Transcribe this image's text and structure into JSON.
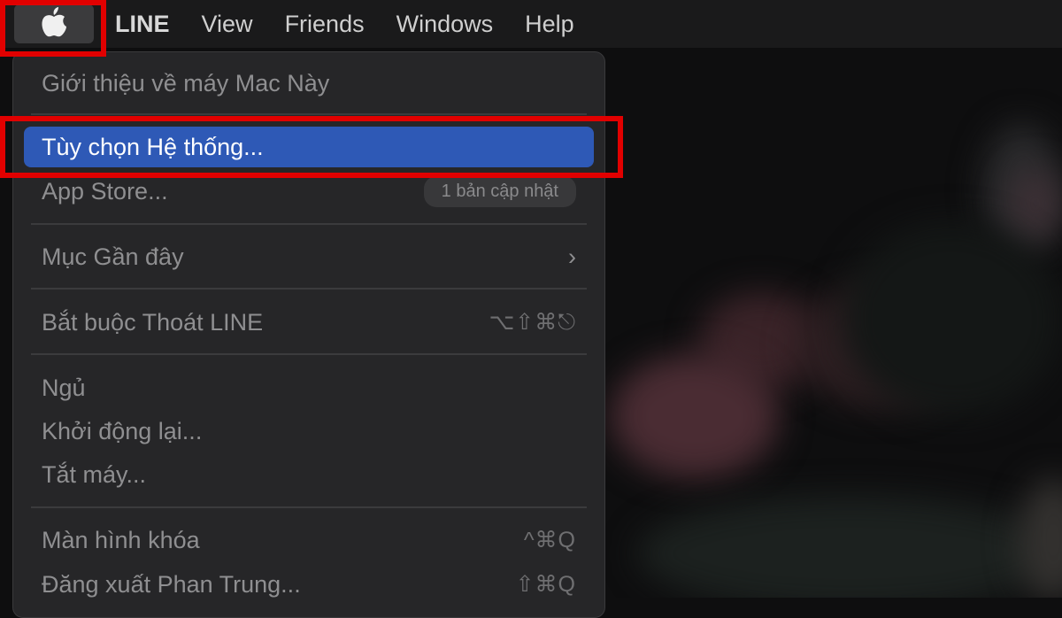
{
  "menubar": {
    "apple_icon": "apple-logo-icon",
    "items": [
      "LINE",
      "View",
      "Friends",
      "Windows",
      "Help"
    ]
  },
  "apple_menu": {
    "about": "Giới thiệu về máy Mac Này",
    "system_prefs": "Tùy chọn Hệ thống...",
    "app_store": "App Store...",
    "app_store_badge": "1 bản cập nhật",
    "recent_items": "Mục Gần đây",
    "recent_items_chevron": "›",
    "force_quit": "Bắt buộc Thoát LINE",
    "force_quit_shortcut": "⌥⇧⌘⎋",
    "sleep": "Ngủ",
    "restart": "Khởi động lại...",
    "shutdown": "Tắt máy...",
    "lock_screen": "Màn hình khóa",
    "lock_screen_shortcut": "^⌘Q",
    "logout": "Đăng xuất Phan Trung...",
    "logout_shortcut": "⇧⌘Q"
  },
  "colors": {
    "highlight_box": "#e10000",
    "selection": "#2e59b6"
  }
}
